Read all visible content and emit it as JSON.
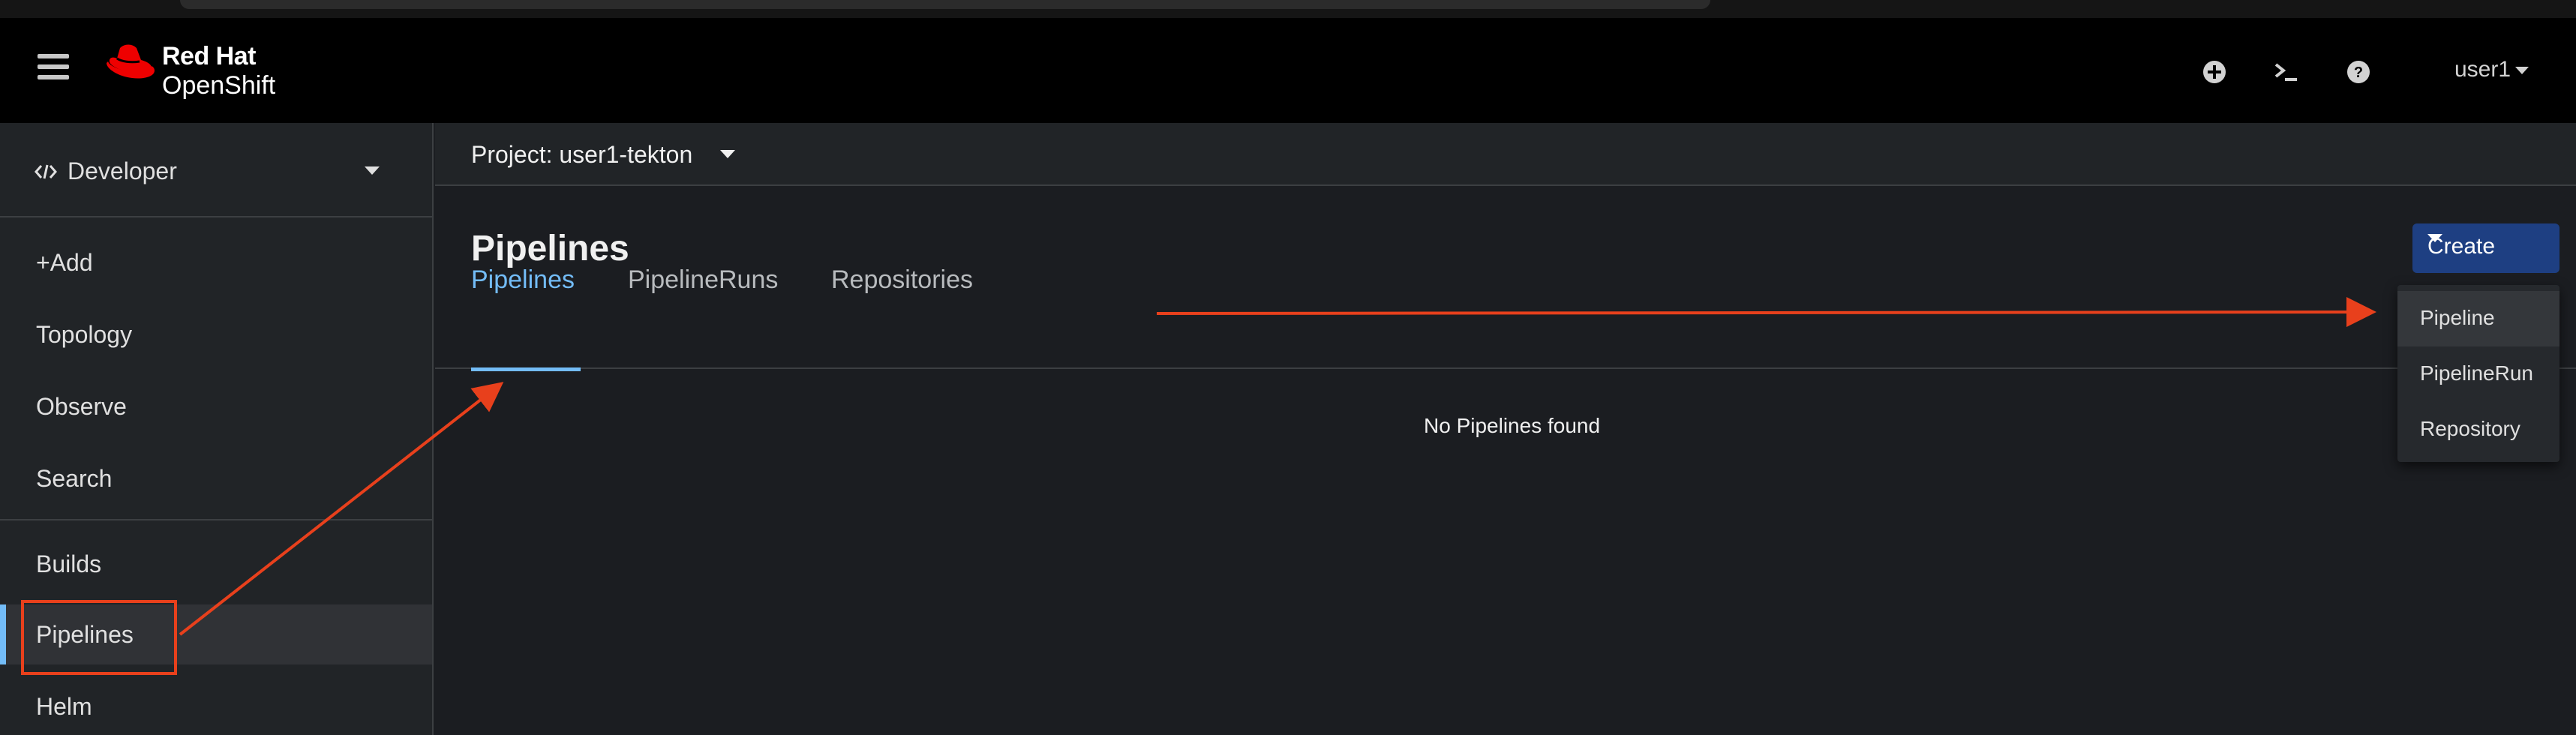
{
  "masthead": {
    "brand_line1": "Red Hat",
    "brand_line2": "OpenShift",
    "icons": [
      "add-icon",
      "terminal-icon",
      "help-icon"
    ],
    "user": "user1"
  },
  "sidebar": {
    "perspective": "Developer",
    "items": [
      {
        "label": "+Add"
      },
      {
        "label": "Topology"
      },
      {
        "label": "Observe"
      },
      {
        "label": "Search"
      },
      {
        "label": "Builds"
      },
      {
        "label": "Pipelines",
        "active": true
      },
      {
        "label": "Helm"
      }
    ]
  },
  "main": {
    "project": "Project: user1-tekton",
    "title": "Pipelines",
    "tabs": [
      {
        "label": "Pipelines",
        "active": true
      },
      {
        "label": "PipelineRuns"
      },
      {
        "label": "Repositories"
      }
    ],
    "empty_message": "No Pipelines found"
  },
  "create": {
    "label": "Create",
    "menu": [
      "Pipeline",
      "PipelineRun",
      "Repository"
    ]
  },
  "colors": {
    "masthead_bg": "#000000",
    "sidebar_bg": "#212427",
    "content_bg": "#1b1d21",
    "accent_blue": "#73bcf7",
    "create_button": "#1e3f82",
    "annotation_red": "#e8401c",
    "brand_red": "#ee0000"
  }
}
